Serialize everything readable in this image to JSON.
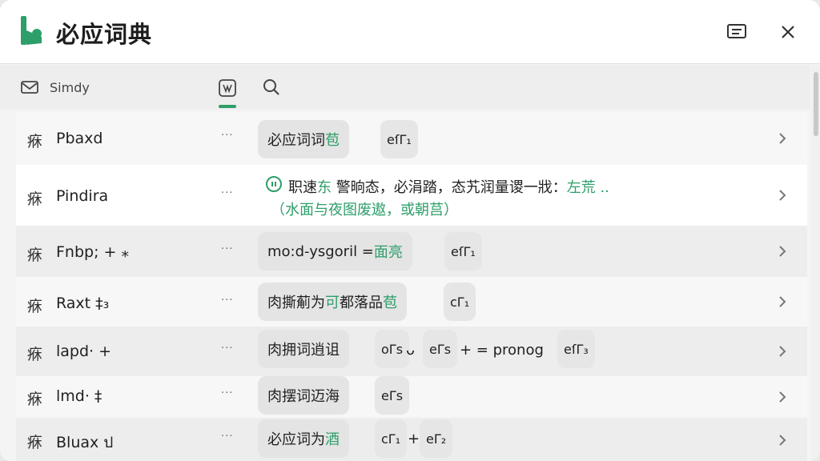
{
  "app": {
    "title": "必应词典",
    "brand_color": "#2e9e6a"
  },
  "titlebar": {
    "notes_icon": "notes-icon",
    "close_icon": "close-icon"
  },
  "toolbar": {
    "user": "Simdy",
    "mail_icon": "mail-icon",
    "dict_icon": "dictionary-icon",
    "search_icon": "search-icon"
  },
  "rows": [
    {
      "icon": "㾋",
      "word": "Pbaxd",
      "dots": "···",
      "chip_main": "必应词词",
      "chip_hl": "苞",
      "tag1": "eſΓ₁",
      "tags": []
    },
    {
      "icon": "㾋",
      "word": "Pindira",
      "dots": "···",
      "def_line1": "职速",
      "def_line1_hl": "东",
      "def_line1_rest": " 警晌态，必涓踏，态艽润量谡一戕：",
      "def_line1_tail": "左荒 ..",
      "def_line2": "（水面与夜图废遨，或朝莒）"
    },
    {
      "icon": "㾋",
      "word": "Fnbp; + ⁎",
      "dots": "···",
      "chip_main": "mo:d-ysgoril =",
      "chip_hl": " 面亮",
      "tag1": "eſΓ₁"
    },
    {
      "icon": "㾋",
      "word": "Raxt ‡₃",
      "dots": "···",
      "chip_main": "肉撕葪为",
      "chip_hl": "可",
      "chip_after": "都落品",
      "chip_hl2": "苞",
      "tag1": "cΓ₁"
    },
    {
      "icon": "㾋",
      "word": "lapd· +",
      "dots": "···",
      "chip_main": "肉拥词逍诅",
      "tag1": "oΓs",
      "mid1": "ᴗ",
      "tag2": "eΓs",
      "mid2": "+ = pronog",
      "tag3": "eſΓ₃"
    },
    {
      "icon": "㾋",
      "word": "lmd· ‡",
      "dots": "···",
      "chip_main": "肉摆词迈海",
      "tag1": "eΓs"
    },
    {
      "icon": "㾋",
      "word": "Bluax ป",
      "dots": "···",
      "chip_main": "必应词为",
      "chip_hl": "酒",
      "tag1": "cΓ₁",
      "mid1": "+",
      "tag2": "eΓ₂"
    }
  ]
}
